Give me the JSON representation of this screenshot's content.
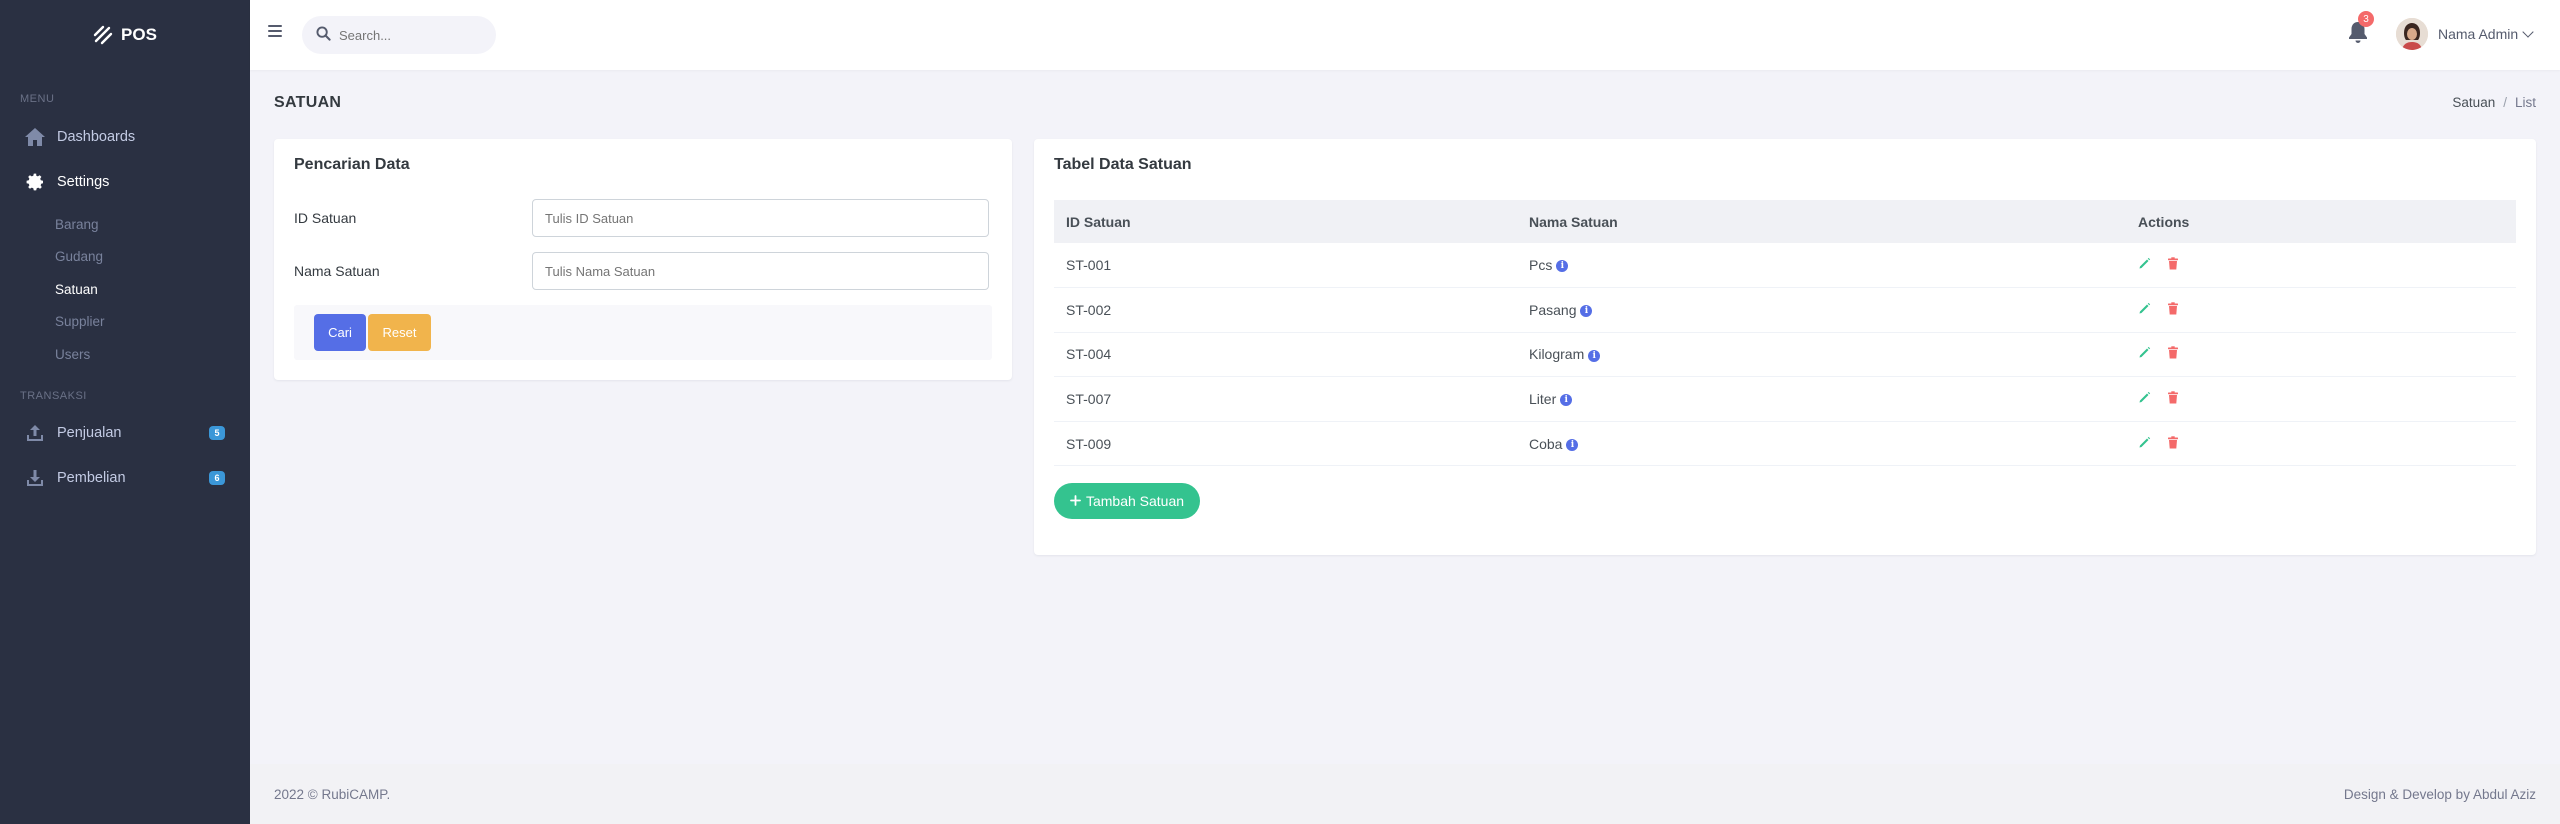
{
  "app": {
    "logo_text": "POS"
  },
  "sidebar": {
    "menu_title": "MENU",
    "items": [
      {
        "label": "Dashboards",
        "icon": "home-icon"
      },
      {
        "label": "Settings",
        "icon": "gear-icon"
      }
    ],
    "sub_items": [
      "Barang",
      "Gudang",
      "Satuan",
      "Supplier",
      "Users"
    ],
    "active_sub_item": "Satuan",
    "trans_title": "TRANSAKSI",
    "trans_items": [
      {
        "label": "Penjualan",
        "icon": "upload-icon",
        "badge": "5"
      },
      {
        "label": "Pembelian",
        "icon": "download-icon",
        "badge": "6"
      }
    ]
  },
  "topbar": {
    "search_placeholder": "Search...",
    "notification_count": "3",
    "user_name": "Nama Admin"
  },
  "page": {
    "title": "SATUAN",
    "breadcrumb": [
      "Satuan",
      "List"
    ]
  },
  "search_card": {
    "title": "Pencarian Data",
    "id_label": "ID Satuan",
    "id_placeholder": "Tulis ID Satuan",
    "name_label": "Nama Satuan",
    "name_placeholder": "Tulis Nama Satuan",
    "search_button": "Cari",
    "reset_button": "Reset"
  },
  "table_card": {
    "title": "Tabel Data Satuan",
    "columns": [
      "ID Satuan",
      "Nama Satuan",
      "Actions"
    ],
    "rows": [
      {
        "id": "ST-001",
        "name": "Pcs"
      },
      {
        "id": "ST-002",
        "name": "Pasang"
      },
      {
        "id": "ST-004",
        "name": "Kilogram"
      },
      {
        "id": "ST-007",
        "name": "Liter"
      },
      {
        "id": "ST-009",
        "name": "Coba"
      }
    ],
    "add_button": "Tambah Satuan"
  },
  "footer": {
    "left": "2022 © RubiCAMP.",
    "right": "Design & Develop by Abdul Aziz"
  },
  "colors": {
    "sidebar_bg": "#2a3042",
    "primary": "#556ee6",
    "warning": "#f1b44c",
    "success": "#34c38f",
    "danger": "#f46a6a"
  }
}
